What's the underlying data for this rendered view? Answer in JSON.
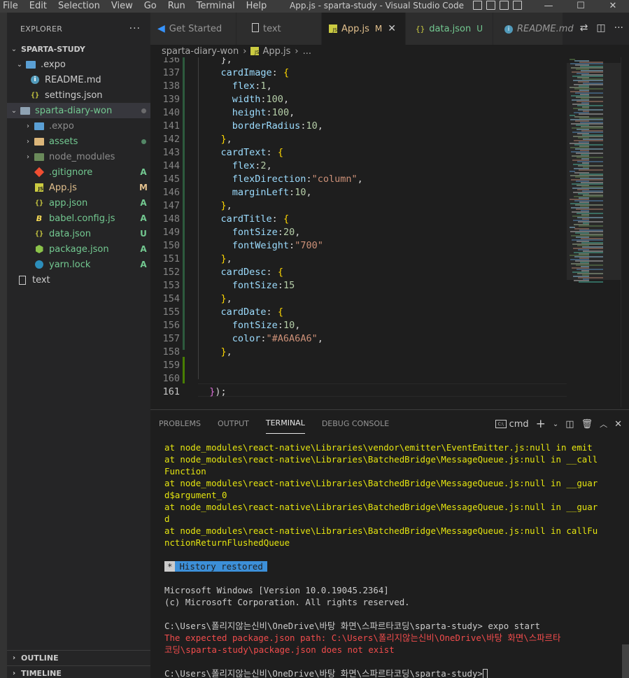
{
  "titlebar": {
    "menu": [
      "File",
      "Edit",
      "Selection",
      "View",
      "Go",
      "Run",
      "Terminal",
      "Help"
    ],
    "title": "App.js - sparta-study - Visual Studio Code",
    "controls": {
      "minimize": "—",
      "maximize": "☐",
      "close": "✕"
    }
  },
  "sidebar": {
    "header": "EXPLORER",
    "more": "···",
    "root": "SPARTA-STUDY",
    "items": [
      {
        "label": ".expo",
        "status": ""
      },
      {
        "label": "README.md",
        "status": ""
      },
      {
        "label": "settings.json",
        "status": ""
      },
      {
        "label": "sparta-diary-won",
        "status": ""
      },
      {
        "label": ".expo",
        "status": ""
      },
      {
        "label": "assets",
        "status": ""
      },
      {
        "label": "node_modules",
        "status": ""
      },
      {
        "label": ".gitignore",
        "status": "A"
      },
      {
        "label": "App.js",
        "status": "M"
      },
      {
        "label": "app.json",
        "status": "A"
      },
      {
        "label": "babel.config.js",
        "status": "A"
      },
      {
        "label": "data.json",
        "status": "U"
      },
      {
        "label": "package.json",
        "status": "A"
      },
      {
        "label": "yarn.lock",
        "status": "A"
      },
      {
        "label": "text",
        "status": ""
      }
    ],
    "outline": "OUTLINE",
    "timeline": "TIMELINE"
  },
  "tabs": [
    {
      "label": "Get Started",
      "badge": "",
      "icon": "vscode-icon"
    },
    {
      "label": "text",
      "badge": "",
      "icon": "file-icon"
    },
    {
      "label": "App.js",
      "badge": "M",
      "icon": "js-icon",
      "close": "✕"
    },
    {
      "label": "data.json",
      "badge": "U",
      "icon": "json-icon"
    },
    {
      "label": "README.md",
      "badge": "",
      "icon": "info-icon"
    }
  ],
  "breadcrumb": {
    "folder": "sparta-diary-won",
    "file": "App.js",
    "more": "..."
  },
  "editor": {
    "lines": [
      {
        "n": "136",
        "parts": [
          [
            "pun",
            "    },"
          ]
        ]
      },
      {
        "n": "137",
        "parts": [
          [
            "prop",
            "    cardImage"
          ],
          [
            "pun",
            ": "
          ],
          [
            "brace2",
            "{"
          ]
        ]
      },
      {
        "n": "138",
        "parts": [
          [
            "prop",
            "      flex"
          ],
          [
            "pun",
            ":"
          ],
          [
            "num",
            "1"
          ],
          [
            "pun",
            ","
          ]
        ]
      },
      {
        "n": "139",
        "parts": [
          [
            "prop",
            "      width"
          ],
          [
            "pun",
            ":"
          ],
          [
            "num",
            "100"
          ],
          [
            "pun",
            ","
          ]
        ]
      },
      {
        "n": "140",
        "parts": [
          [
            "prop",
            "      height"
          ],
          [
            "pun",
            ":"
          ],
          [
            "num",
            "100"
          ],
          [
            "pun",
            ","
          ]
        ]
      },
      {
        "n": "141",
        "parts": [
          [
            "prop",
            "      borderRadius"
          ],
          [
            "pun",
            ":"
          ],
          [
            "num",
            "10"
          ],
          [
            "pun",
            ","
          ]
        ]
      },
      {
        "n": "142",
        "parts": [
          [
            "brace2",
            "    }"
          ],
          [
            "pun",
            ","
          ]
        ]
      },
      {
        "n": "143",
        "parts": [
          [
            "prop",
            "    cardText"
          ],
          [
            "pun",
            ": "
          ],
          [
            "brace2",
            "{"
          ]
        ]
      },
      {
        "n": "144",
        "parts": [
          [
            "prop",
            "      flex"
          ],
          [
            "pun",
            ":"
          ],
          [
            "num",
            "2"
          ],
          [
            "pun",
            ","
          ]
        ]
      },
      {
        "n": "145",
        "parts": [
          [
            "prop",
            "      flexDirection"
          ],
          [
            "pun",
            ":"
          ],
          [
            "str",
            "\"column\""
          ],
          [
            "pun",
            ","
          ]
        ]
      },
      {
        "n": "146",
        "parts": [
          [
            "prop",
            "      marginLeft"
          ],
          [
            "pun",
            ":"
          ],
          [
            "num",
            "10"
          ],
          [
            "pun",
            ","
          ]
        ]
      },
      {
        "n": "147",
        "parts": [
          [
            "brace2",
            "    }"
          ],
          [
            "pun",
            ","
          ]
        ]
      },
      {
        "n": "148",
        "parts": [
          [
            "prop",
            "    cardTitle"
          ],
          [
            "pun",
            ": "
          ],
          [
            "brace2",
            "{"
          ]
        ]
      },
      {
        "n": "149",
        "parts": [
          [
            "prop",
            "      fontSize"
          ],
          [
            "pun",
            ":"
          ],
          [
            "num",
            "20"
          ],
          [
            "pun",
            ","
          ]
        ]
      },
      {
        "n": "150",
        "parts": [
          [
            "prop",
            "      fontWeight"
          ],
          [
            "pun",
            ":"
          ],
          [
            "str",
            "\"700\""
          ]
        ]
      },
      {
        "n": "151",
        "parts": [
          [
            "brace2",
            "    }"
          ],
          [
            "pun",
            ","
          ]
        ]
      },
      {
        "n": "152",
        "parts": [
          [
            "prop",
            "    cardDesc"
          ],
          [
            "pun",
            ": "
          ],
          [
            "brace2",
            "{"
          ]
        ]
      },
      {
        "n": "153",
        "parts": [
          [
            "prop",
            "      fontSize"
          ],
          [
            "pun",
            ":"
          ],
          [
            "num",
            "15"
          ]
        ]
      },
      {
        "n": "154",
        "parts": [
          [
            "brace2",
            "    }"
          ],
          [
            "pun",
            ","
          ]
        ]
      },
      {
        "n": "155",
        "parts": [
          [
            "prop",
            "    cardDate"
          ],
          [
            "pun",
            ": "
          ],
          [
            "brace2",
            "{"
          ]
        ]
      },
      {
        "n": "156",
        "parts": [
          [
            "prop",
            "      fontSize"
          ],
          [
            "pun",
            ":"
          ],
          [
            "num",
            "10"
          ],
          [
            "pun",
            ","
          ]
        ]
      },
      {
        "n": "157",
        "parts": [
          [
            "prop",
            "      color"
          ],
          [
            "pun",
            ":"
          ],
          [
            "str",
            "\"#A6A6A6\""
          ],
          [
            "pun",
            ","
          ]
        ]
      },
      {
        "n": "158",
        "parts": [
          [
            "brace2",
            "    }"
          ],
          [
            "pun",
            ","
          ]
        ]
      },
      {
        "n": "159",
        "parts": []
      },
      {
        "n": "160",
        "parts": []
      },
      {
        "n": "161",
        "parts": [
          [
            "brace",
            "  }"
          ],
          [
            "pun",
            ");"
          ]
        ]
      }
    ]
  },
  "panel": {
    "tabs": [
      "PROBLEMS",
      "OUTPUT",
      "TERMINAL",
      "DEBUG CONSOLE"
    ],
    "active_tab": "TERMINAL",
    "shell": "cmd",
    "terminal_lines": [
      {
        "cls": "tyellow",
        "text": "at node_modules\\react-native\\Libraries\\vendor\\emitter\\EventEmitter.js:null in emit"
      },
      {
        "cls": "tyellow",
        "text": "at node_modules\\react-native\\Libraries\\BatchedBridge\\MessageQueue.js:null in __call"
      },
      {
        "cls": "tyellow",
        "text": "Function"
      },
      {
        "cls": "tyellow",
        "text": "at node_modules\\react-native\\Libraries\\BatchedBridge\\MessageQueue.js:null in __guar"
      },
      {
        "cls": "tyellow",
        "text": "d$argument_0"
      },
      {
        "cls": "tyellow",
        "text": "at node_modules\\react-native\\Libraries\\BatchedBridge\\MessageQueue.js:null in __guar"
      },
      {
        "cls": "tyellow",
        "text": "d"
      },
      {
        "cls": "tyellow",
        "text": "at node_modules\\react-native\\Libraries\\BatchedBridge\\MessageQueue.js:null in callFu"
      },
      {
        "cls": "tyellow",
        "text": "nctionReturnFlushedQueue"
      },
      {
        "cls": "twhite",
        "text": ""
      },
      {
        "cls": "hist",
        "text": "History restored"
      },
      {
        "cls": "twhite",
        "text": ""
      },
      {
        "cls": "twhite",
        "text": "Microsoft Windows [Version 10.0.19045.2364]"
      },
      {
        "cls": "twhite",
        "text": "(c) Microsoft Corporation. All rights reserved."
      },
      {
        "cls": "twhite",
        "text": ""
      },
      {
        "cls": "twhite",
        "text": "C:\\Users\\폴리지않는신비\\OneDrive\\바탕 화면\\스파르타코딩\\sparta-study> expo start"
      },
      {
        "cls": "tred",
        "text": "The expected package.json path: C:\\Users\\폴리지않는신비\\OneDrive\\바탕 화면\\스파르타"
      },
      {
        "cls": "tred",
        "text": "코딩\\sparta-study\\package.json does not exist"
      },
      {
        "cls": "twhite",
        "text": ""
      },
      {
        "cls": "prompt",
        "text": "C:\\Users\\폴리지않는신비\\OneDrive\\바탕 화면\\스파르타코딩\\sparta-study>"
      }
    ],
    "history_star": "*"
  }
}
